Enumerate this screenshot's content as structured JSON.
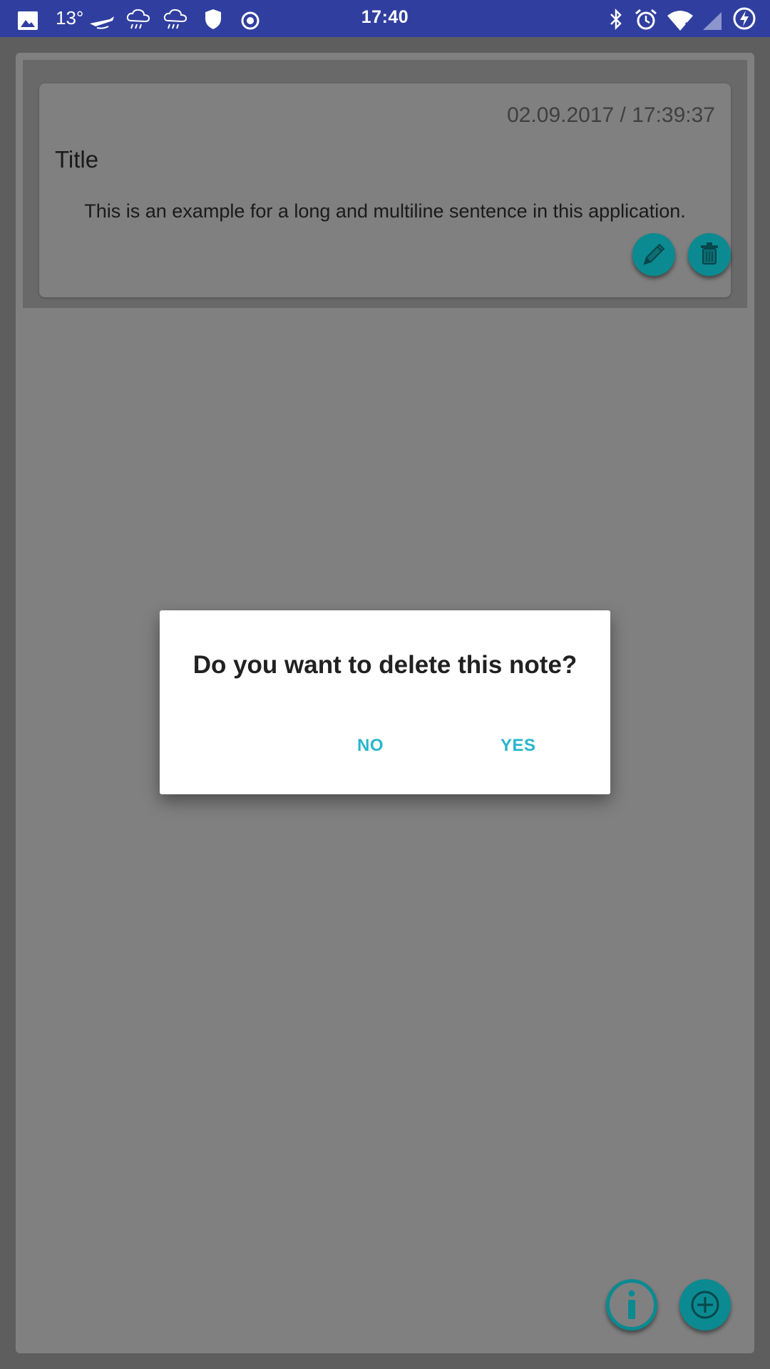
{
  "status_bar": {
    "time": "17:40",
    "temperature": "13°",
    "left_icons": [
      "image-icon",
      "temperature-text",
      "airplane-icon",
      "rain-cloud-icon",
      "rain-cloud-icon",
      "shield-icon",
      "record-icon"
    ],
    "right_icons": [
      "bluetooth-icon",
      "alarm-icon",
      "wifi-icon",
      "signal-icon",
      "battery-charging-icon"
    ],
    "bar_color": "#303f9f"
  },
  "note": {
    "date": "02.09.2017 / 17:39:37",
    "title": "Title",
    "body": "This is an example for a long and multiline sentence in this application.",
    "edit_icon": "pencil-icon",
    "delete_icon": "trash-icon"
  },
  "dialog": {
    "message": "Do you want to delete this note?",
    "no_label": "NO",
    "yes_label": "YES",
    "accent_color": "#26b6cc"
  },
  "fab": {
    "info_icon": "info-icon",
    "add_icon": "add-icon",
    "color": "#0b8a91"
  }
}
